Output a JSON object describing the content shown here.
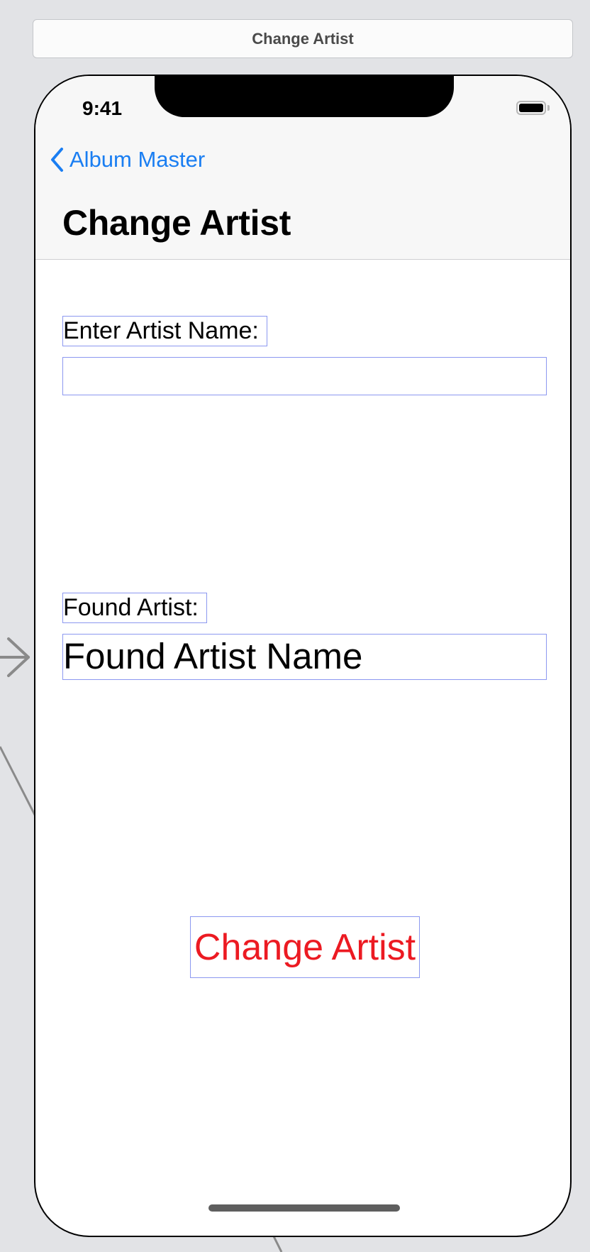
{
  "scene": {
    "title": "Change Artist"
  },
  "status_bar": {
    "time": "9:41"
  },
  "nav": {
    "back_label": "Album Master",
    "title": "Change Artist"
  },
  "form": {
    "enter_label": "Enter Artist Name:",
    "artist_input_value": "",
    "artist_input_placeholder": "",
    "found_label": "Found Artist:",
    "found_name": "Found Artist Name",
    "button_label": "Change Artist"
  },
  "icons": {
    "back": "chevron-left-icon",
    "battery": "battery-icon",
    "segue_arrow": "arrow-right-icon"
  },
  "colors": {
    "tint": "#1a7ef2",
    "button_text": "#ec1a22",
    "outline": "#8c98f0"
  }
}
